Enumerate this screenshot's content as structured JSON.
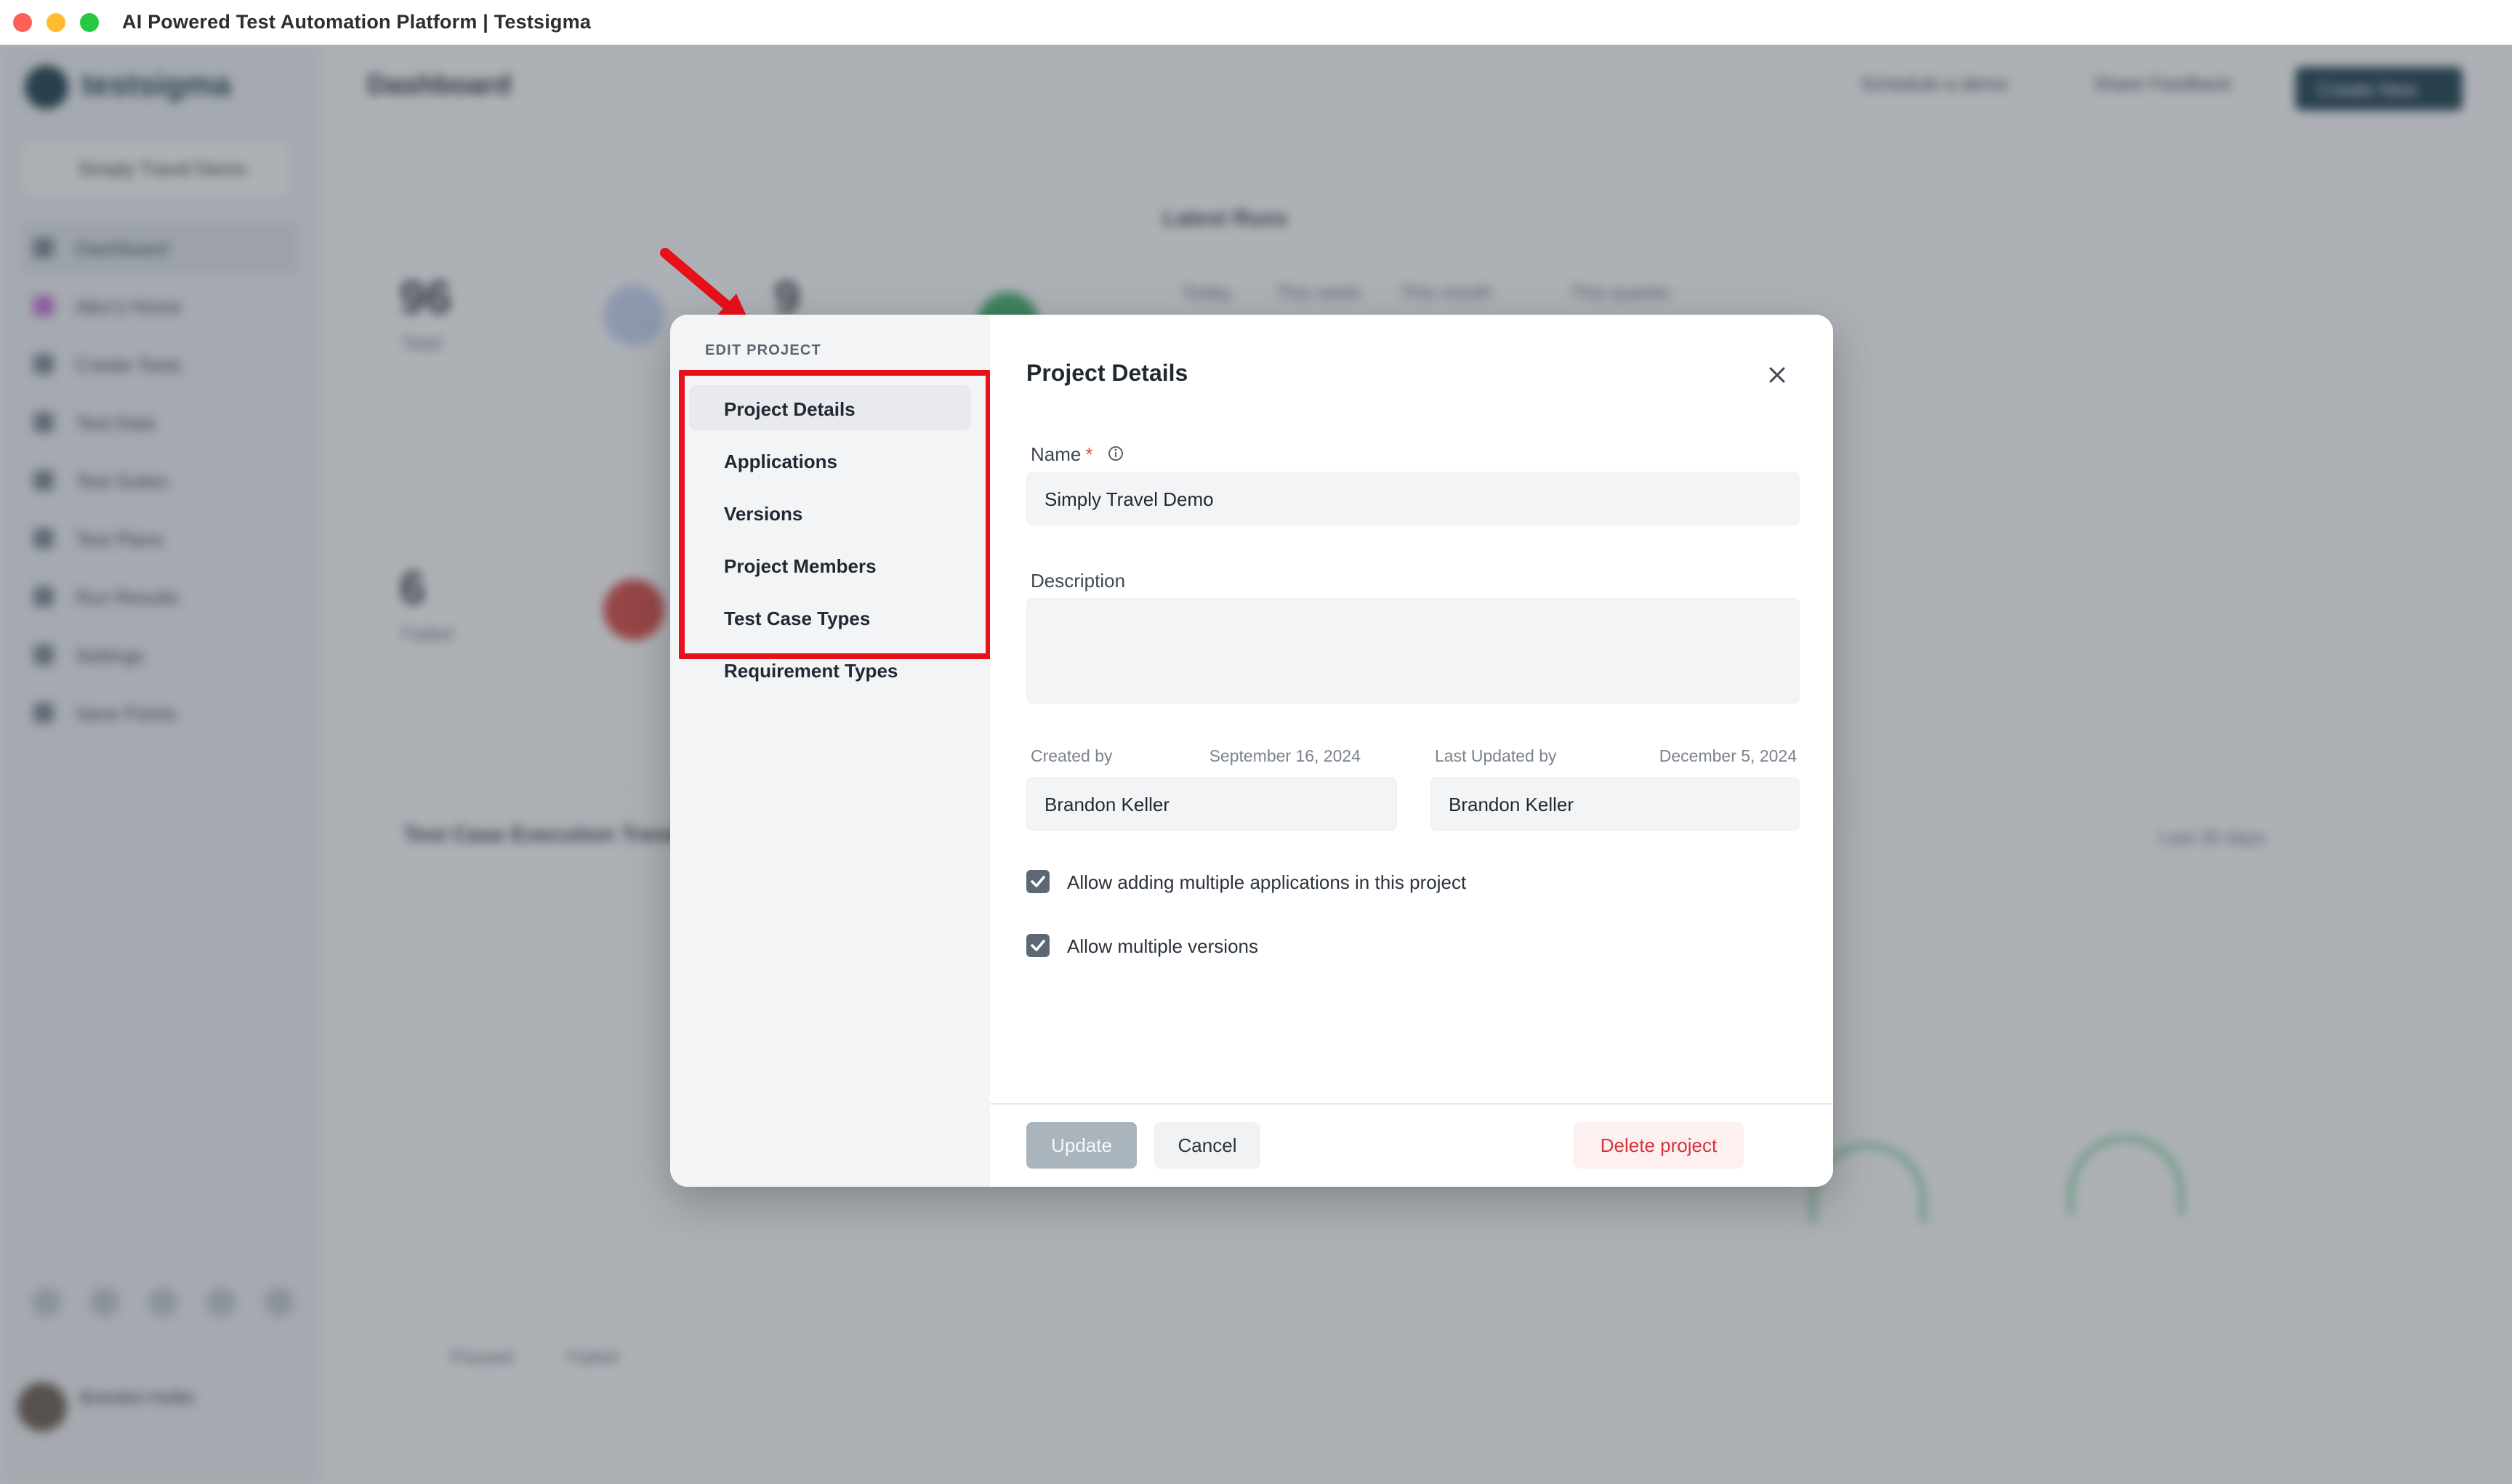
{
  "window": {
    "title": "AI Powered Test Automation Platform | Testsigma"
  },
  "background_app": {
    "brand": "testsigma",
    "project": "Simply Travel Demo",
    "page_title": "Dashboard",
    "nav": [
      "Dashboard",
      "Alex's Home",
      "Create Tests",
      "Test Data",
      "Test Suites",
      "Test Plans",
      "Run Results",
      "Settings",
      "Save Points"
    ],
    "header_actions": {
      "schedule": "Schedule a demo",
      "feedback": "Share Feedback",
      "create": "Create New"
    },
    "stats": [
      {
        "value": "96",
        "label": "Total"
      },
      {
        "value": "9",
        "label": ""
      },
      {
        "value": "6",
        "label": "Failed"
      }
    ],
    "latest_runs_title": "Latest Runs",
    "run_filters": [
      "Today",
      "This week",
      "This month",
      "This quarter"
    ],
    "chart_title": "Test Case Execution Trend",
    "chart_range": "Last 30 days",
    "legend": [
      "Passed",
      "Failed"
    ],
    "user": "Brandon Keller"
  },
  "modal": {
    "side_title": "EDIT PROJECT",
    "side_items": [
      {
        "label": "Project Details",
        "active": true
      },
      {
        "label": "Applications",
        "active": false
      },
      {
        "label": "Versions",
        "active": false
      },
      {
        "label": "Project Members",
        "active": false
      },
      {
        "label": "Test Case Types",
        "active": false
      },
      {
        "label": "Requirement Types",
        "active": false
      }
    ],
    "title": "Project Details",
    "name_label": "Name",
    "name_required": "*",
    "name_value": "Simply Travel Demo",
    "description_label": "Description",
    "description_value": "",
    "created_by_label": "Created by",
    "created_date": "September 16, 2024",
    "created_by_value": "Brandon Keller",
    "updated_by_label": "Last Updated by",
    "updated_date": "December 5, 2024",
    "updated_by_value": "Brandon Keller",
    "checkbox_multi_apps": {
      "label": "Allow adding multiple applications in this project",
      "checked": true
    },
    "checkbox_multi_versions": {
      "label": "Allow multiple versions",
      "checked": true
    },
    "update_label": "Update",
    "cancel_label": "Cancel",
    "delete_label": "Delete project"
  },
  "colors": {
    "highlight": "#e8101a",
    "brand_dark": "#1c3d4a",
    "danger": "#d4343b"
  }
}
